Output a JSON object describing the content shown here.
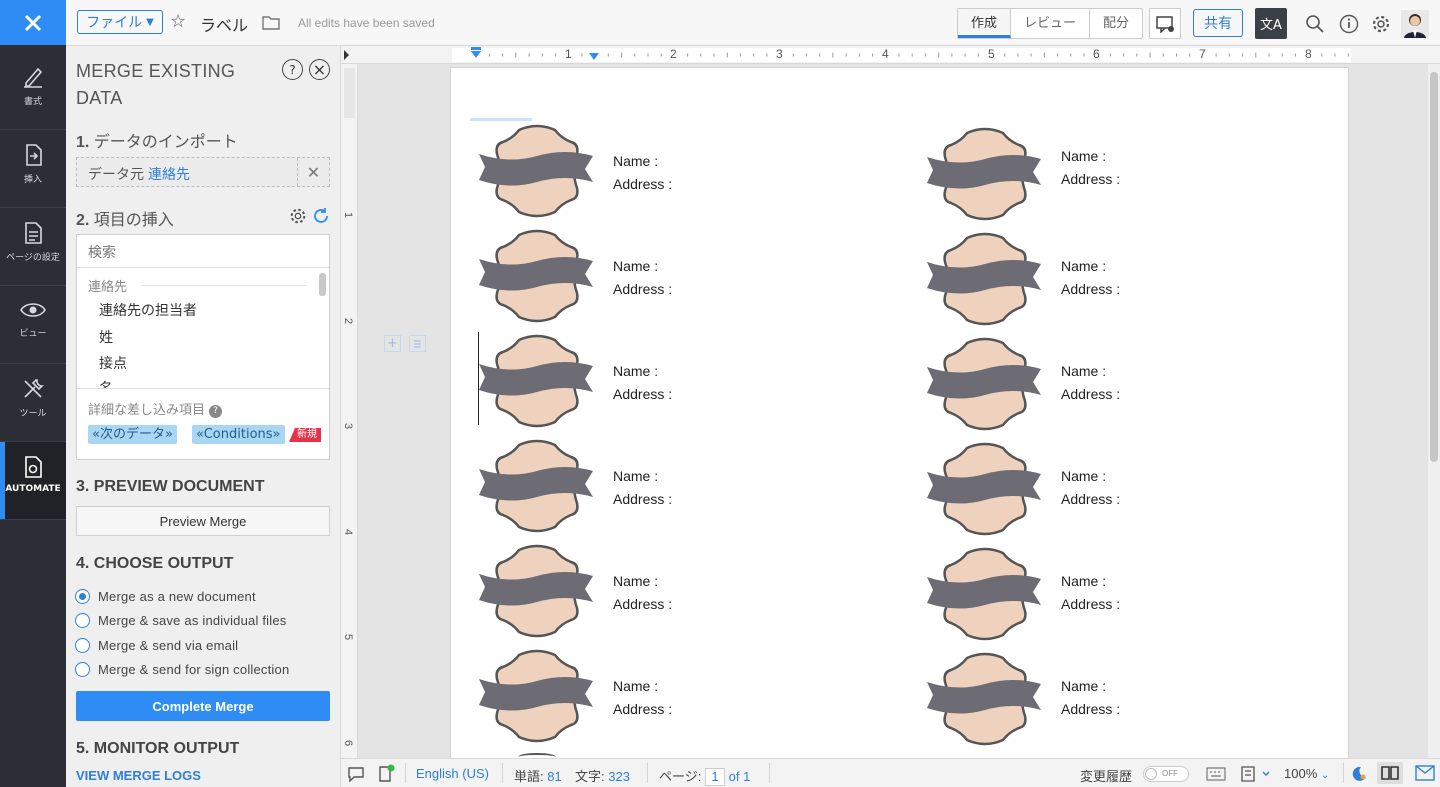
{
  "rail": {
    "items": [
      {
        "label": "書式",
        "icon": "format-brush-icon"
      },
      {
        "label": "挿入",
        "icon": "insert-icon"
      },
      {
        "label": "ページの設定",
        "icon": "page-setup-icon"
      },
      {
        "label": "ビュー",
        "icon": "eye-icon"
      },
      {
        "label": "ツール",
        "icon": "tools-icon"
      },
      {
        "label": "AUTOMATE",
        "icon": "automate-icon"
      }
    ],
    "active": "AUTOMATE"
  },
  "topbar": {
    "file_label": "ファイル",
    "doc_title": "ラベル",
    "save_status": "All edits have been saved",
    "modes": [
      "作成",
      "レビュー",
      "配分"
    ],
    "active_mode": "作成",
    "share_label": "共有",
    "translate_label": "文A"
  },
  "panel": {
    "title": "MERGE EXISTING DATA",
    "help": "?",
    "close": "×",
    "s1": {
      "num": "1.",
      "title": "データのインポート",
      "source_label": "データ元",
      "source_value": "連絡先"
    },
    "s2": {
      "num": "2.",
      "title": "項目の挿入",
      "search_placeholder": "検索",
      "group": "連絡先",
      "fields": [
        "連絡先の担当者",
        "姓",
        "接点",
        "名"
      ],
      "advanced_label": "詳細な差し込み項目",
      "tags": [
        "«次のデータ»",
        "«Conditions»"
      ],
      "new_badge": "新規"
    },
    "s3": {
      "title": "3. PREVIEW DOCUMENT",
      "button": "Preview Merge"
    },
    "s4": {
      "title": "4. CHOOSE OUTPUT",
      "options": [
        "Merge as a new document",
        "Merge & save as individual files",
        "Merge & send via email",
        "Merge & send for sign collection"
      ],
      "selected": 0,
      "button": "Complete Merge"
    },
    "s5": {
      "title": "5. MONITOR OUTPUT",
      "link": "VIEW MERGE LOGS"
    }
  },
  "ruler": {
    "h": [
      "1",
      "2",
      "3",
      "4",
      "5",
      "6",
      "7",
      "8"
    ],
    "v": [
      "1",
      "2",
      "3",
      "4",
      "5",
      "6"
    ]
  },
  "labels": {
    "name": "Name :",
    "address": "Address :",
    "rows": 6,
    "cols": 2
  },
  "status": {
    "language": "English (US)",
    "words_label": "単語:",
    "words": "81",
    "chars_label": "文字:",
    "chars": "323",
    "page_label": "ページ:",
    "page": "1",
    "page_of": "of 1",
    "track_label": "変更履歴",
    "toggle": "OFF",
    "zoom": "100%"
  }
}
